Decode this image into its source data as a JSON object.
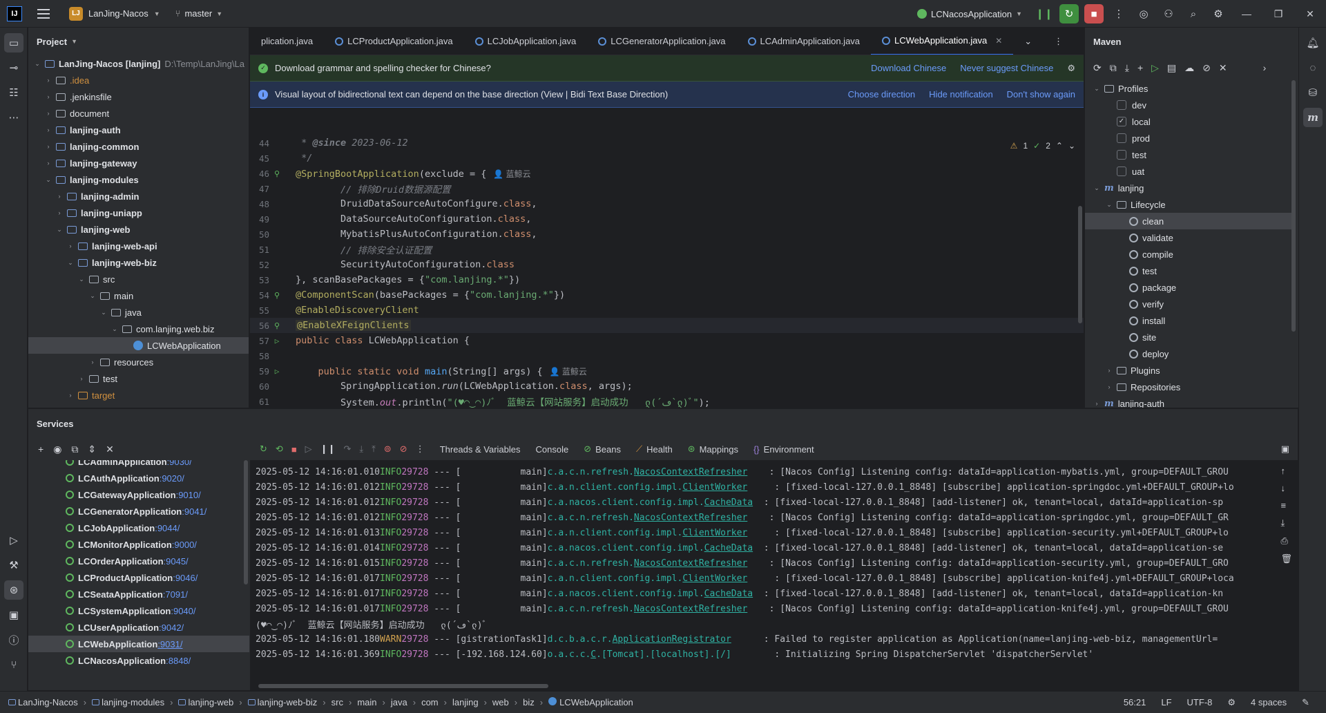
{
  "titlebar": {
    "logo": "IJ",
    "project_badge": "LJ",
    "project_name": "LanJing-Nacos",
    "branch": "master",
    "run_config": "LCNacosApplication"
  },
  "project_panel": {
    "title": "Project",
    "root_name": "LanJing-Nacos [lanjing]",
    "root_path": "D:\\Temp\\LanJing\\La",
    "items": [
      {
        "label": ".idea",
        "depth": 1,
        "kind": "folder-orange-text",
        "expanded": false
      },
      {
        "label": ".jenkinsfile",
        "depth": 1,
        "kind": "folder",
        "expanded": false
      },
      {
        "label": "document",
        "depth": 1,
        "kind": "folder",
        "expanded": false
      },
      {
        "label": "lanjing-auth",
        "depth": 1,
        "kind": "module",
        "expanded": false
      },
      {
        "label": "lanjing-common",
        "depth": 1,
        "kind": "module",
        "expanded": false
      },
      {
        "label": "lanjing-gateway",
        "depth": 1,
        "kind": "module",
        "expanded": false
      },
      {
        "label": "lanjing-modules",
        "depth": 1,
        "kind": "module",
        "expanded": true
      },
      {
        "label": "lanjing-admin",
        "depth": 2,
        "kind": "module",
        "expanded": false
      },
      {
        "label": "lanjing-uniapp",
        "depth": 2,
        "kind": "module",
        "expanded": false
      },
      {
        "label": "lanjing-web",
        "depth": 2,
        "kind": "module",
        "expanded": true
      },
      {
        "label": "lanjing-web-api",
        "depth": 3,
        "kind": "module",
        "expanded": false
      },
      {
        "label": "lanjing-web-biz",
        "depth": 3,
        "kind": "module",
        "expanded": true
      },
      {
        "label": "src",
        "depth": 4,
        "kind": "plain",
        "expanded": true
      },
      {
        "label": "main",
        "depth": 5,
        "kind": "plain",
        "expanded": true
      },
      {
        "label": "java",
        "depth": 6,
        "kind": "plain",
        "expanded": true
      },
      {
        "label": "com.lanjing.web.biz",
        "depth": 7,
        "kind": "plain",
        "expanded": true
      },
      {
        "label": "LCWebApplication",
        "depth": 8,
        "kind": "class",
        "expanded": null
      },
      {
        "label": "resources",
        "depth": 5,
        "kind": "plain",
        "expanded": false
      },
      {
        "label": "test",
        "depth": 4,
        "kind": "plain",
        "expanded": false
      },
      {
        "label": "target",
        "depth": 3,
        "kind": "orange",
        "expanded": false
      }
    ]
  },
  "editor": {
    "tabs": [
      {
        "label": "plication.java",
        "active": false
      },
      {
        "label": "LCProductApplication.java",
        "active": false
      },
      {
        "label": "LCJobApplication.java",
        "active": false
      },
      {
        "label": "LCGeneratorApplication.java",
        "active": false
      },
      {
        "label": "LCAdminApplication.java",
        "active": false
      },
      {
        "label": "LCWebApplication.java",
        "active": true
      }
    ],
    "notif1": {
      "text": "Download grammar and spelling checker for Chinese?",
      "actions": [
        "Download Chinese",
        "Never suggest Chinese"
      ]
    },
    "notif2": {
      "text": "Visual layout of bidirectional text can depend on the base direction (View | Bidi Text Base Direction)",
      "actions": [
        "Choose direction",
        "Hide notification",
        "Don't show again"
      ]
    },
    "inspection": {
      "warnings": "1",
      "ok": "2"
    },
    "lines": [
      {
        "n": "44",
        "html": "<span class=\"cmt\"> * </span><span class=\"cmt\" style=\"font-weight:bold\">@since</span><span class=\"cmt\"> 2023-06-12</span>"
      },
      {
        "n": "45",
        "html": "<span class=\"cmt\"> */</span>"
      },
      {
        "n": "46",
        "gutter": "bean",
        "html": "<span class=\"ann\">@SpringBootApplication</span>(exclude = {<span class=\"hint\">👤 蓝鲸云</span>"
      },
      {
        "n": "47",
        "html": "        <span class=\"cmt\">// 排除Druid数据源配置</span>"
      },
      {
        "n": "48",
        "html": "        DruidDataSourceAutoConfigure.<span class=\"kw\">class</span>,"
      },
      {
        "n": "49",
        "html": "        DataSourceAutoConfiguration.<span class=\"kw\">class</span>,"
      },
      {
        "n": "50",
        "html": "        MybatisPlusAutoConfiguration.<span class=\"kw\">class</span>,"
      },
      {
        "n": "51",
        "html": "        <span class=\"cmt\">// 排除安全认证配置</span>"
      },
      {
        "n": "52",
        "html": "        SecurityAutoConfiguration.<span class=\"kw\">class</span>"
      },
      {
        "n": "53",
        "html": "}, scanBasePackages = {<span class=\"str\">\"com.lanjing.*\"</span>})"
      },
      {
        "n": "54",
        "gutter": "bean",
        "html": "<span class=\"ann\">@ComponentScan</span>(basePackages = {<span class=\"str\">\"com.lanjing.*\"</span>})"
      },
      {
        "n": "55",
        "html": "<span class=\"ann\">@EnableDiscoveryClient</span>"
      },
      {
        "n": "56",
        "gutter": "bean",
        "cur": true,
        "html": "<span class=\"ann chip\">@EnableXFeignClients</span>"
      },
      {
        "n": "57",
        "gutter": "run",
        "html": "<span class=\"kw\">public class</span> LCWebApplication {"
      },
      {
        "n": "58",
        "html": ""
      },
      {
        "n": "59",
        "gutter": "run",
        "html": "    <span class=\"kw\">public static void</span> <span class=\"fn\">main</span>(String[] args) {<span class=\"hint\">👤 蓝鲸云</span>"
      },
      {
        "n": "60",
        "html": "        SpringApplication.<span style=\"font-style:italic\">run</span>(LCWebApplication.<span class=\"kw\">class</span>, args);"
      },
      {
        "n": "61",
        "html": "        System.<span style=\"font-style:italic;color:#c77dbb\">out</span>.println(<span class=\"str\">\"(♥◠‿◠)ﾉﾞ  蓝鲸云【网站服务】启动成功   ლ(´ڡ`ლ)ﾞ\"</span>);"
      },
      {
        "n": "62",
        "html": "    }"
      }
    ]
  },
  "maven": {
    "title": "Maven",
    "tree": [
      {
        "label": "Profiles",
        "depth": 0,
        "kind": "folder",
        "tw": "v"
      },
      {
        "label": "dev",
        "depth": 1,
        "kind": "check",
        "checked": false
      },
      {
        "label": "local",
        "depth": 1,
        "kind": "check",
        "checked": true
      },
      {
        "label": "prod",
        "depth": 1,
        "kind": "check",
        "checked": false
      },
      {
        "label": "test",
        "depth": 1,
        "kind": "check",
        "checked": false
      },
      {
        "label": "uat",
        "depth": 1,
        "kind": "check",
        "checked": false
      },
      {
        "label": "lanjing",
        "depth": 0,
        "kind": "m",
        "tw": "v"
      },
      {
        "label": "Lifecycle",
        "depth": 1,
        "kind": "folder",
        "tw": "v"
      },
      {
        "label": "clean",
        "depth": 2,
        "kind": "gear",
        "sel": true
      },
      {
        "label": "validate",
        "depth": 2,
        "kind": "gear"
      },
      {
        "label": "compile",
        "depth": 2,
        "kind": "gear"
      },
      {
        "label": "test",
        "depth": 2,
        "kind": "gear"
      },
      {
        "label": "package",
        "depth": 2,
        "kind": "gear"
      },
      {
        "label": "verify",
        "depth": 2,
        "kind": "gear"
      },
      {
        "label": "install",
        "depth": 2,
        "kind": "gear"
      },
      {
        "label": "site",
        "depth": 2,
        "kind": "gear"
      },
      {
        "label": "deploy",
        "depth": 2,
        "kind": "gear"
      },
      {
        "label": "Plugins",
        "depth": 1,
        "kind": "folder",
        "tw": ">"
      },
      {
        "label": "Repositories",
        "depth": 1,
        "kind": "folder",
        "tw": ">"
      },
      {
        "label": "lanjing-auth",
        "depth": 0,
        "kind": "m",
        "tw": ">"
      }
    ]
  },
  "services": {
    "title": "Services",
    "items": [
      {
        "name": "LCAdminApplication",
        "port": ":9030/"
      },
      {
        "name": "LCAuthApplication",
        "port": ":9020/"
      },
      {
        "name": "LCGatewayApplication",
        "port": ":9010/"
      },
      {
        "name": "LCGeneratorApplication",
        "port": ":9041/"
      },
      {
        "name": "LCJobApplication",
        "port": ":9044/"
      },
      {
        "name": "LCMonitorApplication",
        "port": ":9000/"
      },
      {
        "name": "LCOrderApplication",
        "port": ":9045/"
      },
      {
        "name": "LCProductApplication",
        "port": ":9046/"
      },
      {
        "name": "LCSeataApplication",
        "port": ":7091/"
      },
      {
        "name": "LCSystemApplication",
        "port": ":9040/"
      },
      {
        "name": "LCUserApplication",
        "port": ":9042/"
      },
      {
        "name": "LCWebApplication",
        "port": ":9031/",
        "sel": true
      },
      {
        "name": "LCNacosApplication",
        "port": ":8848/"
      }
    ],
    "console_tabs": [
      "Threads & Variables",
      "Console",
      "Beans",
      "Health",
      "Mappings",
      "Environment"
    ],
    "logs": [
      {
        "ts": "2025-05-12 14:16:01.010",
        "lvl": "INFO",
        "pid": "29728",
        "thread": "           main]",
        "logger_pre": "c.a.c.n.refresh.",
        "logger_u": "NacosContextRefresher",
        "logger_post": "    ",
        "msg": ": [Nacos Config] Listening config: dataId=application-mybatis.yml, group=DEFAULT_GROU"
      },
      {
        "ts": "2025-05-12 14:16:01.012",
        "lvl": "INFO",
        "pid": "29728",
        "thread": "           main]",
        "logger_pre": "c.a.n.client.config.impl.",
        "logger_u": "ClientWorker",
        "logger_post": "     ",
        "msg": ": [fixed-local-127.0.0.1_8848] [subscribe] application-springdoc.yml+DEFAULT_GROUP+lo"
      },
      {
        "ts": "2025-05-12 14:16:01.012",
        "lvl": "INFO",
        "pid": "29728",
        "thread": "           main]",
        "logger_pre": "c.a.nacos.client.config.impl.",
        "logger_u": "CacheData",
        "logger_post": "  ",
        "msg": ": [fixed-local-127.0.0.1_8848] [add-listener] ok, tenant=local, dataId=application-sp"
      },
      {
        "ts": "2025-05-12 14:16:01.012",
        "lvl": "INFO",
        "pid": "29728",
        "thread": "           main]",
        "logger_pre": "c.a.c.n.refresh.",
        "logger_u": "NacosContextRefresher",
        "logger_post": "    ",
        "msg": ": [Nacos Config] Listening config: dataId=application-springdoc.yml, group=DEFAULT_GR"
      },
      {
        "ts": "2025-05-12 14:16:01.013",
        "lvl": "INFO",
        "pid": "29728",
        "thread": "           main]",
        "logger_pre": "c.a.n.client.config.impl.",
        "logger_u": "ClientWorker",
        "logger_post": "     ",
        "msg": ": [fixed-local-127.0.0.1_8848] [subscribe] application-security.yml+DEFAULT_GROUP+lo"
      },
      {
        "ts": "2025-05-12 14:16:01.014",
        "lvl": "INFO",
        "pid": "29728",
        "thread": "           main]",
        "logger_pre": "c.a.nacos.client.config.impl.",
        "logger_u": "CacheData",
        "logger_post": "  ",
        "msg": ": [fixed-local-127.0.0.1_8848] [add-listener] ok, tenant=local, dataId=application-se"
      },
      {
        "ts": "2025-05-12 14:16:01.015",
        "lvl": "INFO",
        "pid": "29728",
        "thread": "           main]",
        "logger_pre": "c.a.c.n.refresh.",
        "logger_u": "NacosContextRefresher",
        "logger_post": "    ",
        "msg": ": [Nacos Config] Listening config: dataId=application-security.yml, group=DEFAULT_GRO"
      },
      {
        "ts": "2025-05-12 14:16:01.017",
        "lvl": "INFO",
        "pid": "29728",
        "thread": "           main]",
        "logger_pre": "c.a.n.client.config.impl.",
        "logger_u": "ClientWorker",
        "logger_post": "     ",
        "msg": ": [fixed-local-127.0.0.1_8848] [subscribe] application-knife4j.yml+DEFAULT_GROUP+loca"
      },
      {
        "ts": "2025-05-12 14:16:01.017",
        "lvl": "INFO",
        "pid": "29728",
        "thread": "           main]",
        "logger_pre": "c.a.nacos.client.config.impl.",
        "logger_u": "CacheData",
        "logger_post": "  ",
        "msg": ": [fixed-local-127.0.0.1_8848] [add-listener] ok, tenant=local, dataId=application-kn"
      },
      {
        "ts": "2025-05-12 14:16:01.017",
        "lvl": "INFO",
        "pid": "29728",
        "thread": "           main]",
        "logger_pre": "c.a.c.n.refresh.",
        "logger_u": "NacosContextRefresher",
        "logger_post": "    ",
        "msg": ": [Nacos Config] Listening config: dataId=application-knife4j.yml, group=DEFAULT_GROU"
      },
      {
        "raw": "(♥◠‿◠)ﾉﾞ  蓝鲸云【网站服务】启动成功   ლ(´ڡ`ლ)ﾞ"
      },
      {
        "ts": "2025-05-12 14:16:01.180",
        "lvl": "WARN",
        "pid": "29728",
        "thread": "[gistrationTask1]",
        "logger_pre": "d.c.b.a.c.r.",
        "logger_u": "ApplicationRegistrator",
        "logger_post": "      ",
        "msg": ": Failed to register application as Application(name=lanjing-web-biz, managementUrl="
      },
      {
        "ts": "2025-05-12 14:16:01.369",
        "lvl": "INFO",
        "pid": "29728",
        "thread": "[-192.168.124.60]",
        "logger_pre": "o.a.c.c.",
        "logger_u": "C",
        "logger_post": ".[Tomcat].[localhost].[/]        ",
        "msg": ": Initializing Spring DispatcherServlet 'dispatcherServlet'"
      }
    ]
  },
  "statusbar": {
    "crumbs": [
      "LanJing-Nacos",
      "lanjing-modules",
      "lanjing-web",
      "lanjing-web-biz",
      "src",
      "main",
      "java",
      "com",
      "lanjing",
      "web",
      "biz",
      "LCWebApplication"
    ],
    "position": "56:21",
    "line_sep": "LF",
    "encoding": "UTF-8",
    "indent": "4 spaces"
  }
}
